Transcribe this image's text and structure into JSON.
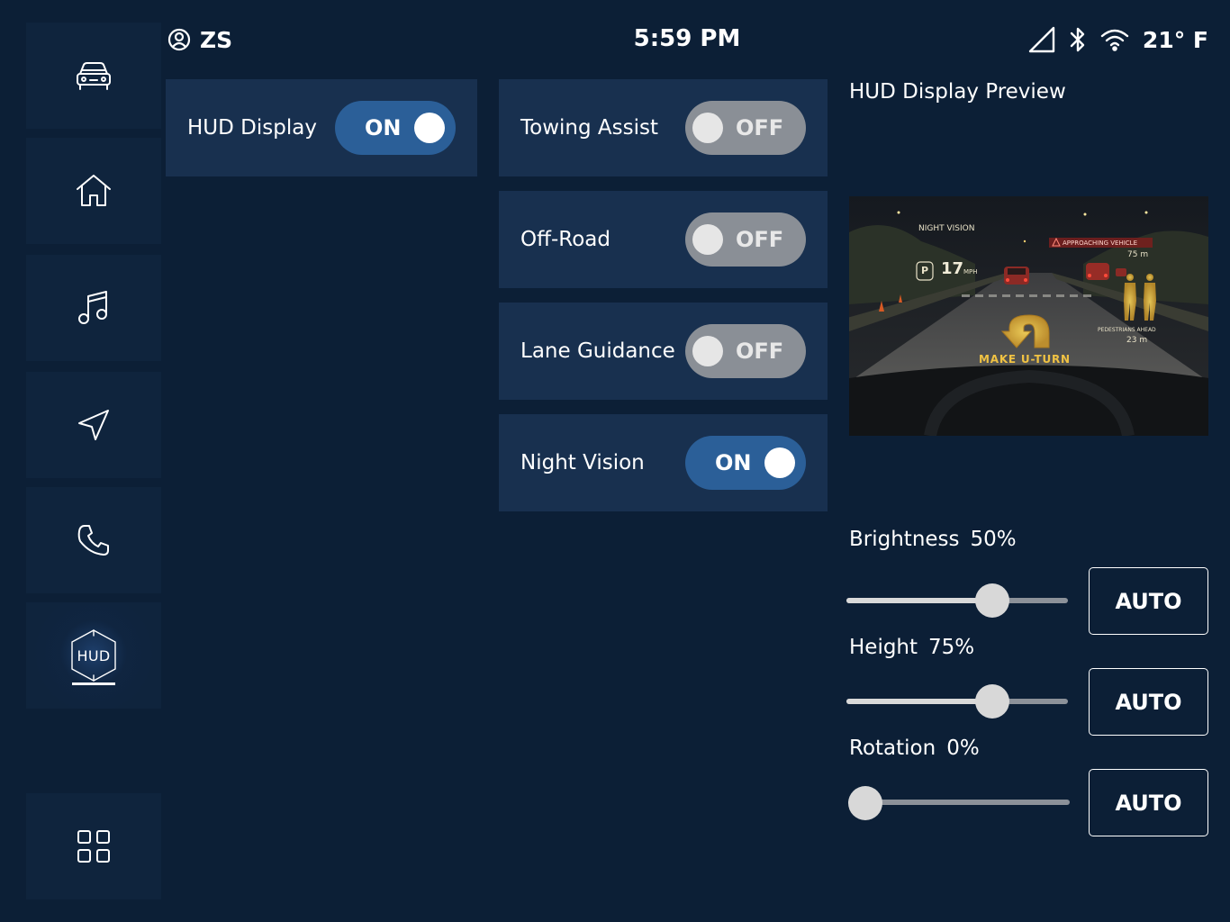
{
  "status": {
    "user_name": "ZS",
    "time": "5:59 PM",
    "temperature": "21° F"
  },
  "sidebar": {
    "items": [
      {
        "name": "car",
        "icon": "car-icon",
        "active": false
      },
      {
        "name": "home",
        "icon": "home-icon",
        "active": false
      },
      {
        "name": "music",
        "icon": "music-note-icon",
        "active": false
      },
      {
        "name": "navigation",
        "icon": "navigation-arrow-icon",
        "active": false
      },
      {
        "name": "phone",
        "icon": "phone-icon",
        "active": false
      },
      {
        "name": "hud",
        "icon": "hud-icon",
        "label": "HUD",
        "active": true
      },
      {
        "name": "apps",
        "icon": "app-grid-icon",
        "active": false
      }
    ]
  },
  "toggles": {
    "hud_display": {
      "label": "HUD Display",
      "state": "ON"
    },
    "towing_assist": {
      "label": "Towing Assist",
      "state": "OFF"
    },
    "off_road": {
      "label": "Off-Road",
      "state": "OFF"
    },
    "lane_guidance": {
      "label": "Lane Guidance",
      "state": "OFF"
    },
    "night_vision": {
      "label": "Night Vision",
      "state": "ON"
    }
  },
  "preview": {
    "title": "HUD Display Preview",
    "night_vision_label": "NIGHT VISION",
    "speed": "17",
    "speed_unit": "MPH",
    "park_symbol": "P",
    "alert_label": "APPROACHING VEHICLE",
    "alert_distance": "75 m",
    "pedestrian_label": "PEDESTRIANS AHEAD",
    "pedestrian_distance": "23 m",
    "instruction": "MAKE U-TURN"
  },
  "sliders": {
    "brightness": {
      "label": "Brightness",
      "value_text": "50%",
      "fraction": 0.66,
      "auto_label": "AUTO"
    },
    "height": {
      "label": "Height",
      "value_text": "75%",
      "fraction": 0.66,
      "auto_label": "AUTO"
    },
    "rotation": {
      "label": "Rotation",
      "value_text": "0%",
      "fraction": 0.0,
      "auto_label": "AUTO"
    }
  },
  "colors": {
    "background": "#0c1f36",
    "card": "#18304f",
    "toggle_on": "#2b5f98",
    "toggle_off": "#8a8f96",
    "hud_yellow": "#f2c744"
  }
}
